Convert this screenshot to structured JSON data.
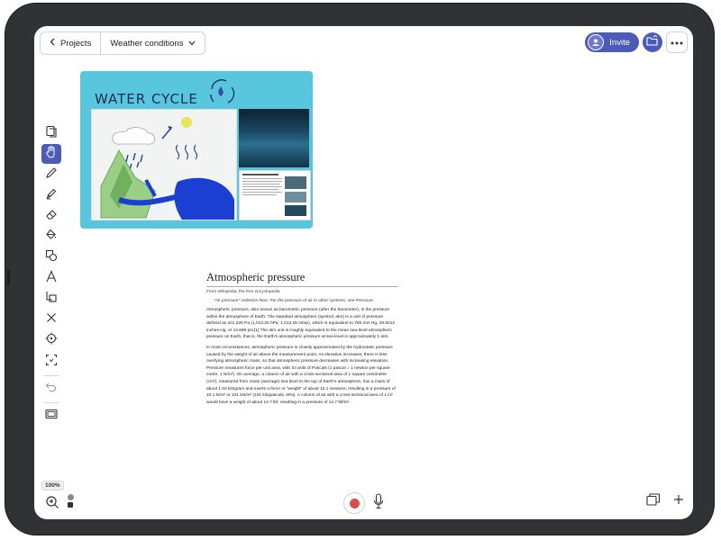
{
  "header": {
    "back_label": "Projects",
    "board_title": "Weather conditions",
    "invite_label": "Invite"
  },
  "toolbar": {
    "tools": [
      "layers-icon",
      "hand-icon",
      "pen-icon",
      "marker-icon",
      "eraser-icon",
      "fill-icon",
      "shapes-icon",
      "text-icon",
      "crop-icon",
      "close-icon",
      "target-icon",
      "frame-icon",
      "undo-icon",
      "minimize-icon"
    ],
    "active_tool": "hand-icon"
  },
  "card": {
    "title": "WATER CYCLE"
  },
  "document": {
    "title": "Atmospheric pressure",
    "from": "From Wikipedia, the free encyclopedia",
    "hatnote": "\"Air pressure\" redirects here. For the pressure of air in other systems, see Pressure.",
    "paragraph1": "Atmospheric pressure, also known as barometric pressure (after the barometer), is the pressure within the atmosphere of Earth. The standard atmosphere (symbol: atm) is a unit of pressure defined as 101,325 Pa (1,013.25 hPa; 1,013.25 mbar), which is equivalent to 760 mm Hg, 29.9212 inches Hg, or 14.696 psi.[1] The atm unit is roughly equivalent to the mean sea-level atmospheric pressure on Earth, that is, the Earth's atmospheric pressure at sea level is approximately 1 atm.",
    "paragraph2": "In most circumstances, atmospheric pressure is closely approximated by the hydrostatic pressure caused by the weight of air above the measurement point. As elevation increases, there is less overlying atmospheric mass, so that atmospheric pressure decreases with increasing elevation. Pressure measures force per unit area, with SI units of Pascals (1 pascal = 1 newton per square metre, 1 N/m²). On average, a column of air with a cross-sectional area of 1 square centimetre (cm²), measured from mean (average) sea level to the top of Earth's atmosphere, has a mass of about 1.03 kilogram and exerts a force or \"weight\" of about 10.1 newtons, resulting in a pressure of 10.1 N/m² or 101 kN/m² (101 kilopascals, kPa). A column of air with a cross-sectional area of 1 in² would have a weight of about 14.7 lbf, resulting in a pressure of 14.7 lbf/in²."
  },
  "footer": {
    "zoom_level": "100%"
  },
  "colors": {
    "accent": "#4b5bb6",
    "card_background": "#58c6dc",
    "record": "#d84c4c"
  }
}
